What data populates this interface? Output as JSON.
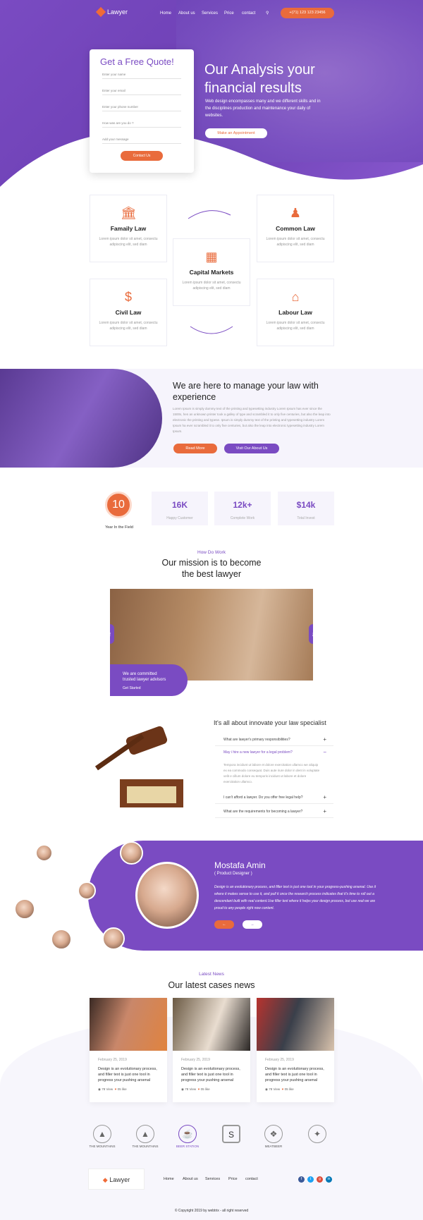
{
  "nav": {
    "logo": "Lawyer",
    "links": [
      "Home",
      "About us",
      "Services",
      "Price",
      "contact"
    ],
    "phone": "+(71) 123 123 23456"
  },
  "hero": {
    "quote_title": "Get a Free Quote!",
    "fields": [
      "Enter your name",
      "Enter your email",
      "Enter your phone number",
      "How was are you do ?",
      "Add your message"
    ],
    "quote_button": "Contact Us",
    "title": "Our Analysis your financial results",
    "desc": "Web design encompasses many  and we different skills and  in  the  disciplines  production and maintenance your daily of websites.",
    "button": "Make an Appointment"
  },
  "services": [
    {
      "title": "Famaily Law",
      "desc": "Lorem ipsum dolor sit amet, consectu adipiscing elit, sed diam"
    },
    {
      "title": "Capital Markets",
      "desc": "Lorem ipsum dolor sit amet, consectu adipiscing elit, sed diam"
    },
    {
      "title": "Common Law",
      "desc": "Lorem ipsum dolor sit amet, consectu adipiscing elit, sed diam"
    },
    {
      "title": "Civil Law",
      "desc": "Lorem ipsum dolor sit amet, consectu adipiscing elit, sed diam"
    },
    {
      "title": "Labour Law",
      "desc": "Lorem ipsum dolor sit amet, consectu adipiscing elit, sed diam"
    }
  ],
  "about": {
    "title": "We are here to manage your law with experience",
    "desc": "Lorem Ipsum is simply dummy text of the printing and typesetting industry Lorem Ipsum has ever since the 1500s, hen an unknown printer took a galley of type and scrambled it to only five centuries, but also the leap into electronic the printing and typese. Ipsum is simply dummy text of the printing and typesetting industry Lorem Ipsum ha ever scrambled it to only five centuries, but also the leap into electronic typesetting industry Lorem Ipsum.",
    "read_more": "Read More",
    "visit": "Visit Our About Us"
  },
  "stats": {
    "years": "10",
    "years_label": "Year In the Field",
    "boxes": [
      {
        "value": "16K",
        "label": "Happy Customer"
      },
      {
        "value": "12k+",
        "label": "Complete Work"
      },
      {
        "value": "$14k",
        "label": "Total Invest"
      }
    ]
  },
  "mission": {
    "tag": "How Do Work",
    "title_1": "Our mission is to  become",
    "title_2": "the best lawyer",
    "caption_1": "We are committed",
    "caption_2": "trusted lawyer advisors",
    "caption_link": "Get Started"
  },
  "faq": {
    "title": "It's all about innovate your law specialist",
    "items": [
      "What are lawyer's primary responsibilities?",
      "May i hire a new lawyer for a legal problem?",
      "I can't afford a lawyer. Do you offer free legal help?",
      "What are the requirements for becoming a lawyer?"
    ],
    "answer": "Tempora incidunt ut labore et dolore exercitation ullamco we aliquip ex ea commodo consequat. Duis aute irure dolor in dent in voluptate velit e cillum dolore eu temporis incidunt ut labore et dolore exercitation ullamco."
  },
  "testimonial": {
    "name": "Mostafa Amin",
    "role": "( Product Designer )",
    "text": "Design is an evolutionary process, and filler text is just one tool in your progress-pushing arsenal. Use it where it makes sense to use it, and pull it once the research process indicates that it's time to roll out a descendant built with real content.Use filler text where it helps your design process, but use real we are proud to any people right now content."
  },
  "news": {
    "tag": "Latest News",
    "title": "Our latest cases news",
    "items": [
      {
        "date": "February 25, 2019",
        "text": "Design is an evolutionary process, and filler text is just one tool in progress your pushing arsenal",
        "views": "78 View",
        "likes": "05 like"
      },
      {
        "date": "February 25, 2019",
        "text": "Design is an evolutionary process, and filler text is just one tool in progress your pushing arsenal",
        "views": "78 View",
        "likes": "05 like"
      },
      {
        "date": "February 25, 2019",
        "text": "Design is an evolutionary process, and filler text is just one tool in progress your pushing arsenal",
        "views": "78 View",
        "likes": "05 like"
      }
    ]
  },
  "brands": [
    "THE MOUNTAINS",
    "THE MOUNTAINS",
    "BEER STATION",
    "S",
    "MEATBEER",
    ""
  ],
  "footer": {
    "logo": "Lawyer",
    "links": [
      "Home",
      "About us",
      "Services",
      "Price",
      "contact"
    ],
    "copyright": "© Copyright 2019 by webtrix - all right reserved"
  },
  "colors": {
    "purple": "#7a4bc2",
    "orange": "#e96b3c"
  }
}
